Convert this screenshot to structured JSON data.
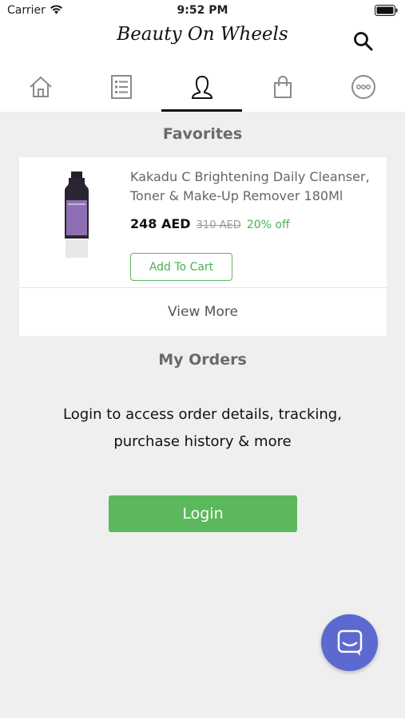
{
  "status_bar": {
    "carrier": "Carrier",
    "time": "9:52 PM"
  },
  "header": {
    "logo_text": "Beauty On Wheels"
  },
  "icons": {
    "wifi": "wifi-icon",
    "battery": "battery-icon",
    "search": "search-icon",
    "nav": [
      "home-icon",
      "orders-list-icon",
      "profile-icon",
      "shopping-bag-icon",
      "more-icon"
    ],
    "chat": "chat-icon"
  },
  "nav": {
    "active_index": 2
  },
  "favorites": {
    "title": "Favorites",
    "product": {
      "name": "Kakadu C Brightening Daily Cleanser, Toner & Make-Up Remover 180Ml",
      "price": "248 AED",
      "old_price": "310 AED",
      "discount": "20% off",
      "add_to_cart_label": "Add To Cart"
    },
    "view_more_label": "View More"
  },
  "orders": {
    "title": "My Orders",
    "message_line1": "Login to access order details, tracking,",
    "message_line2": "purchase history & more",
    "login_label": "Login"
  },
  "colors": {
    "accent_green": "#5cb85c",
    "chat_button": "#5c69d0",
    "background": "#efefef"
  }
}
